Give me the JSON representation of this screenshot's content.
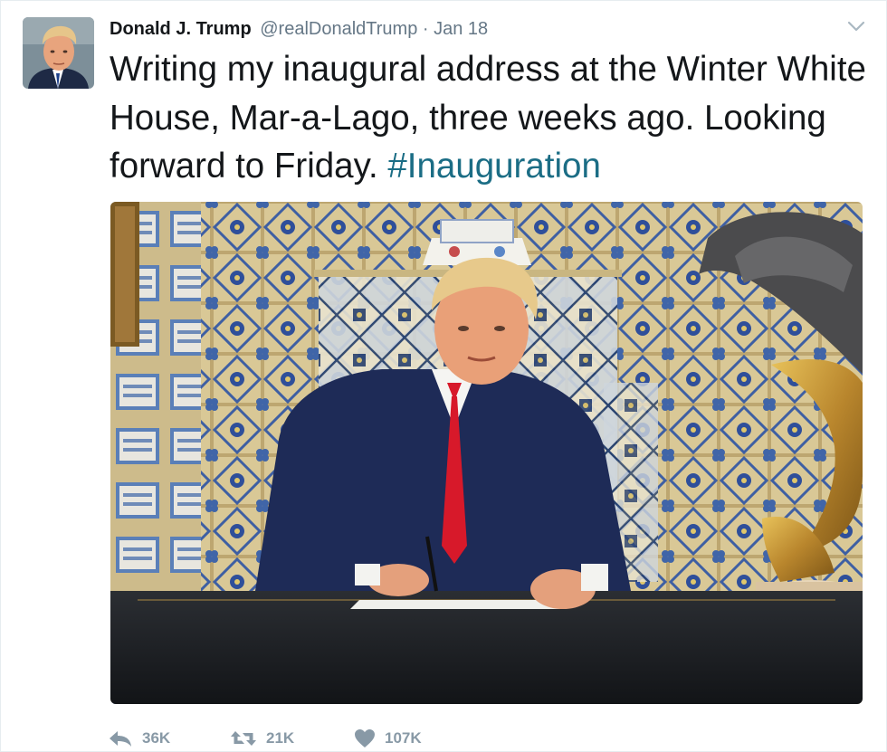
{
  "tweet": {
    "author_name": "Donald J. Trump",
    "handle": "@realDonaldTrump",
    "separator": "·",
    "date": "Jan 18",
    "text_main": "Writing my inaugural address at the Winter White House, Mar-a-Lago, three weeks ago. Looking forward to Friday.",
    "hashtag": "#Inauguration",
    "avatar_icon": "avatar-photo",
    "menu_icon": "chevron-down-icon",
    "image_alt": "Photo: man in navy suit and red tie writing at a desk in front of a tiled wall with a bronze eagle sculpture"
  },
  "actions": {
    "reply_count": "36K",
    "retweet_count": "21K",
    "like_count": "107K"
  },
  "colors": {
    "text": "#14171a",
    "muted": "#657786",
    "action_gray": "#8899a6",
    "hashtag": "#1b6d85",
    "border": "#e6ecf0"
  }
}
